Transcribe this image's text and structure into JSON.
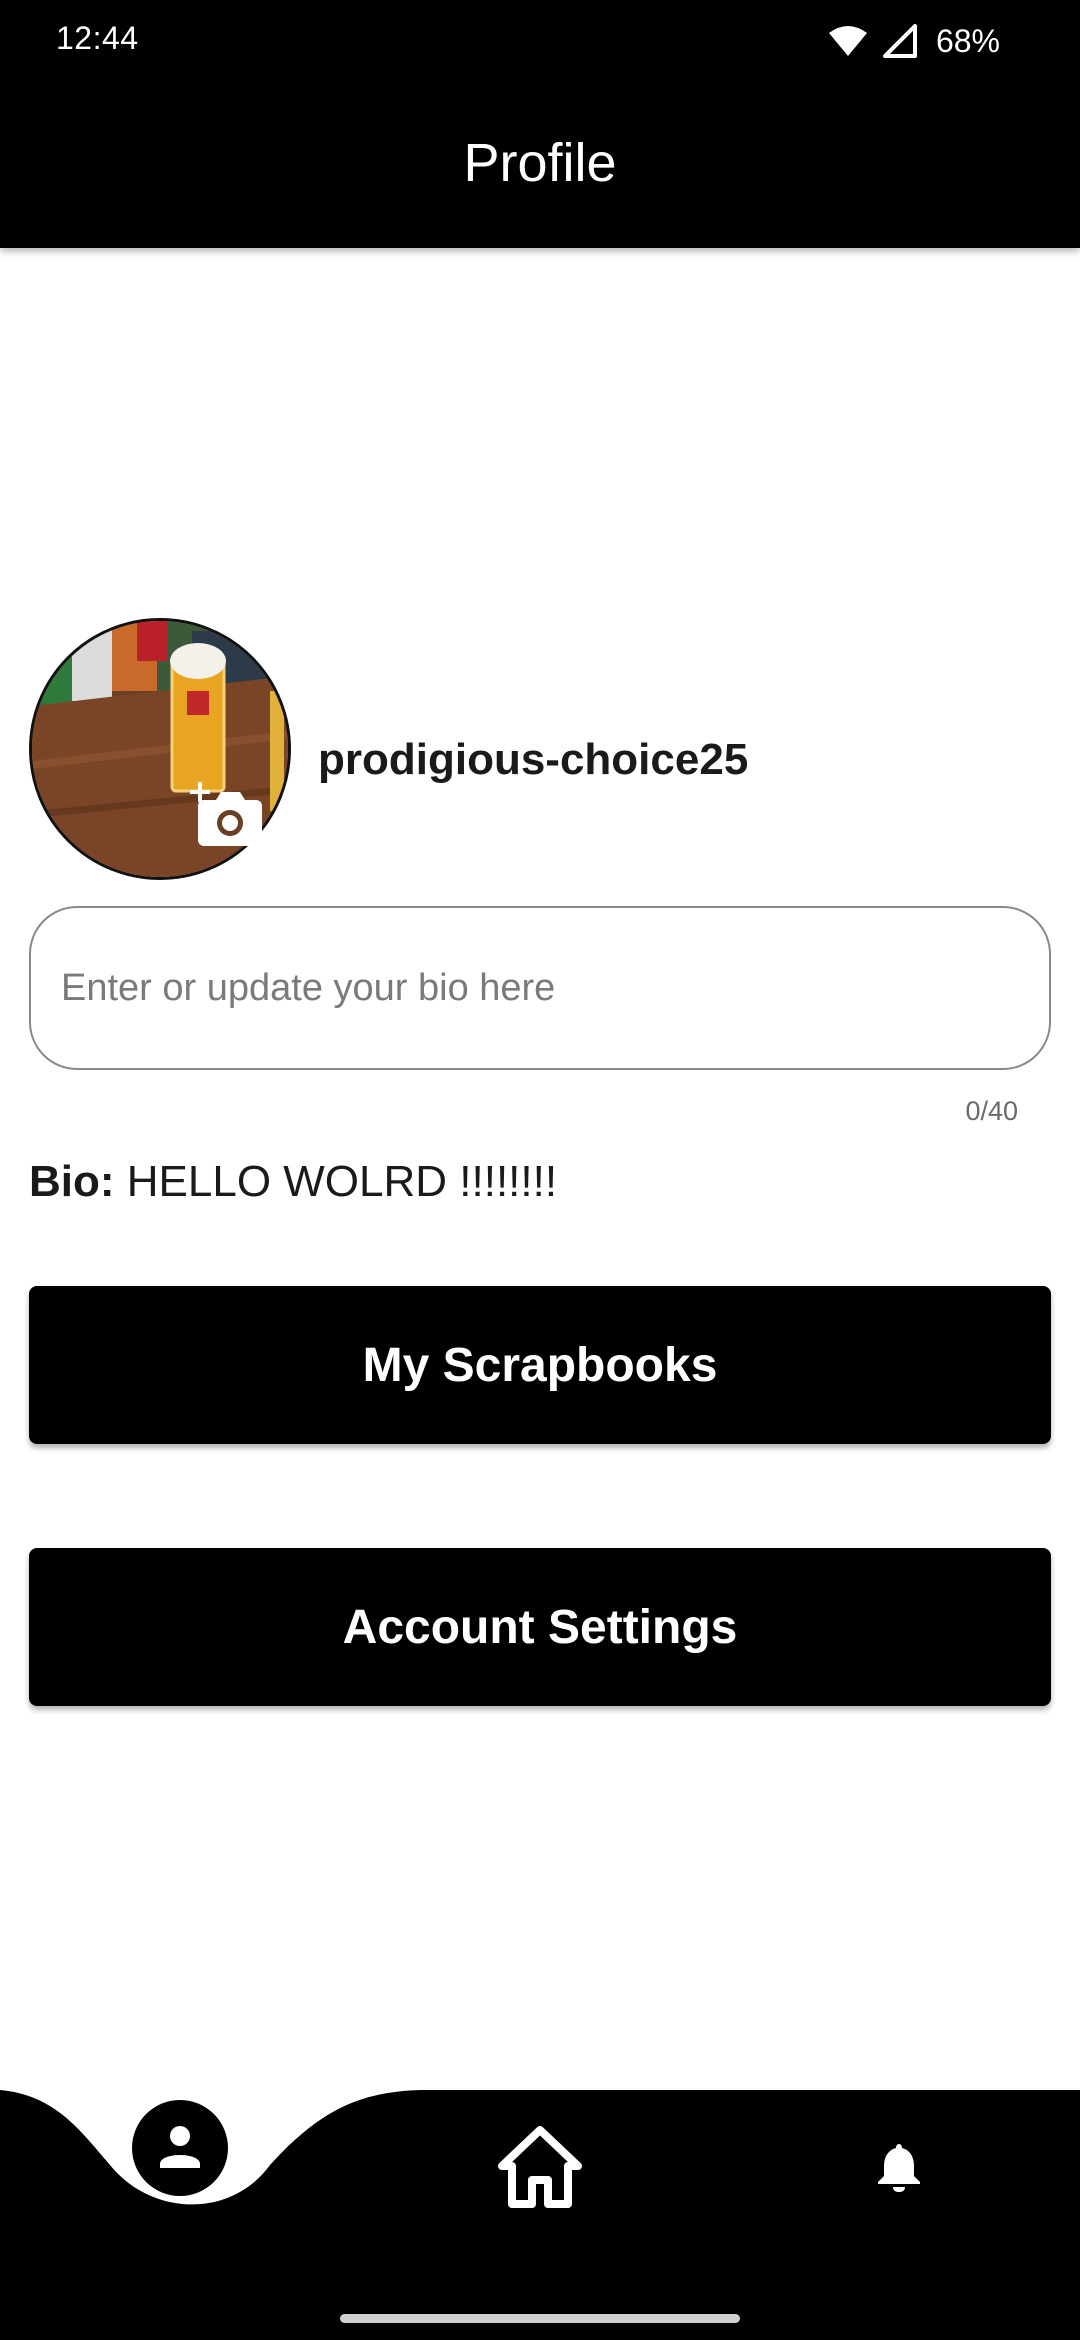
{
  "status_bar": {
    "time": "12:44",
    "battery": "68%"
  },
  "header": {
    "title": "Profile"
  },
  "profile": {
    "username": "prodigious-choice25"
  },
  "bio_input": {
    "placeholder": "Enter or update your bio here",
    "value": "",
    "counter": "0/40"
  },
  "bio": {
    "label": "Bio:",
    "text": "HELLO WOLRD !!!!!!!!"
  },
  "buttons": {
    "scrapbooks_label": "My Scrapbooks",
    "settings_label": "Account Settings"
  },
  "nav": {
    "items": [
      "person-icon",
      "home-icon",
      "bell-icon"
    ],
    "active": "person-icon"
  },
  "colors": {
    "bar": "#000000",
    "background": "#ffffff",
    "input_border": "#8a8a8a"
  }
}
